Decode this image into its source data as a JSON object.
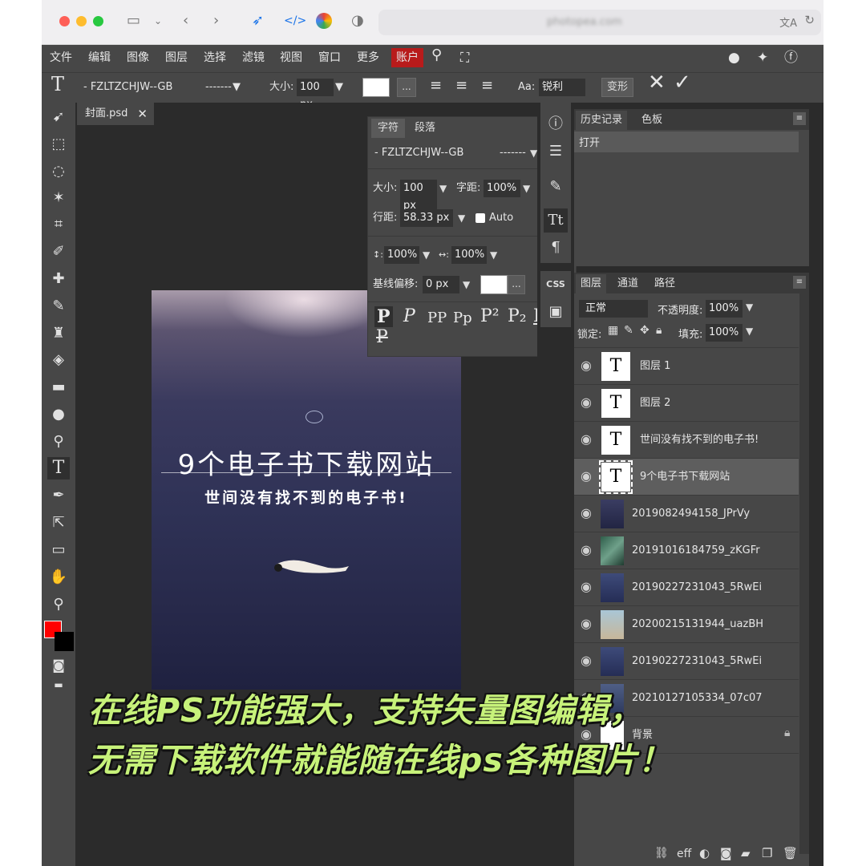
{
  "browser": {
    "address": "photopea.com"
  },
  "menu": {
    "items": [
      "文件",
      "编辑",
      "图像",
      "图层",
      "选择",
      "滤镜",
      "视图",
      "窗口",
      "更多"
    ],
    "account": "账户",
    "accent": "#b81b1b"
  },
  "options": {
    "font": "- FZLTZCHJW--GB",
    "style": "-------",
    "size_label": "大小:",
    "size_value": "100 px",
    "aa_label": "Aa:",
    "aa_value": "锐利",
    "transform_label": "变形",
    "more": "..."
  },
  "document": {
    "tab_name": "封面.psd",
    "title_text": "9个电子书下载网站",
    "subtitle_text": "世间没有找不到的电子书!"
  },
  "character_panel": {
    "tabs": [
      "字符",
      "段落"
    ],
    "font": "- FZLTZCHJW--GB",
    "style": "-------",
    "size_label": "大小:",
    "size_value": "100 px",
    "tracking_label": "字距:",
    "tracking_value": "100%",
    "leading_label": "行距:",
    "leading_value": "58.33 px",
    "auto_label": "Auto",
    "vscale_value": "100%",
    "hscale_value": "100%",
    "baseline_label": "基线偏移:",
    "baseline_value": "0 px",
    "more": "...",
    "styles": [
      "P",
      "P",
      "PP",
      "Pp",
      "P²",
      "P₂",
      "P",
      "P"
    ]
  },
  "history_panel": {
    "tabs": [
      "历史记录",
      "色板"
    ],
    "items": [
      "打开"
    ]
  },
  "layers_panel": {
    "tabs": [
      "图层",
      "通道",
      "路径"
    ],
    "blend_mode": "正常",
    "opacity_label": "不透明度:",
    "opacity_value": "100%",
    "lock_label": "锁定:",
    "fill_label": "填充:",
    "fill_value": "100%",
    "layers": [
      {
        "name": "图层 1",
        "kind": "text"
      },
      {
        "name": "图层 2",
        "kind": "text"
      },
      {
        "name": "世间没有找不到的电子书!",
        "kind": "text"
      },
      {
        "name": "9个电子书下载网站",
        "kind": "text",
        "selected": true
      },
      {
        "name": "2019082494158_JPrVy",
        "kind": "image"
      },
      {
        "name": "20191016184759_zKGFr",
        "kind": "image"
      },
      {
        "name": "20190227231043_5RwEi",
        "kind": "image"
      },
      {
        "name": "20200215131944_uazBH",
        "kind": "image"
      },
      {
        "name": "20190227231043_5RwEi",
        "kind": "image"
      },
      {
        "name": "20210127105334_07c07",
        "kind": "image"
      },
      {
        "name": "背景",
        "kind": "background"
      }
    ],
    "footer_eff": "eff"
  },
  "overlay": {
    "line1": "在线PS功能强大，支持矢量图编辑，",
    "line2": "无需下载软件就能随在线ps各种图片！",
    "color": "#c7f27a"
  },
  "tools": [
    "move-icon",
    "marquee-icon",
    "lasso-icon",
    "magic-wand-icon",
    "crop-icon",
    "eyedropper-icon",
    "healing-icon",
    "brush-icon",
    "stamp-icon",
    "eraser-icon",
    "gradient-icon",
    "blur-icon",
    "dodge-icon",
    "type-icon",
    "pen-icon",
    "path-select-icon",
    "shape-icon",
    "hand-icon",
    "zoom-icon"
  ]
}
